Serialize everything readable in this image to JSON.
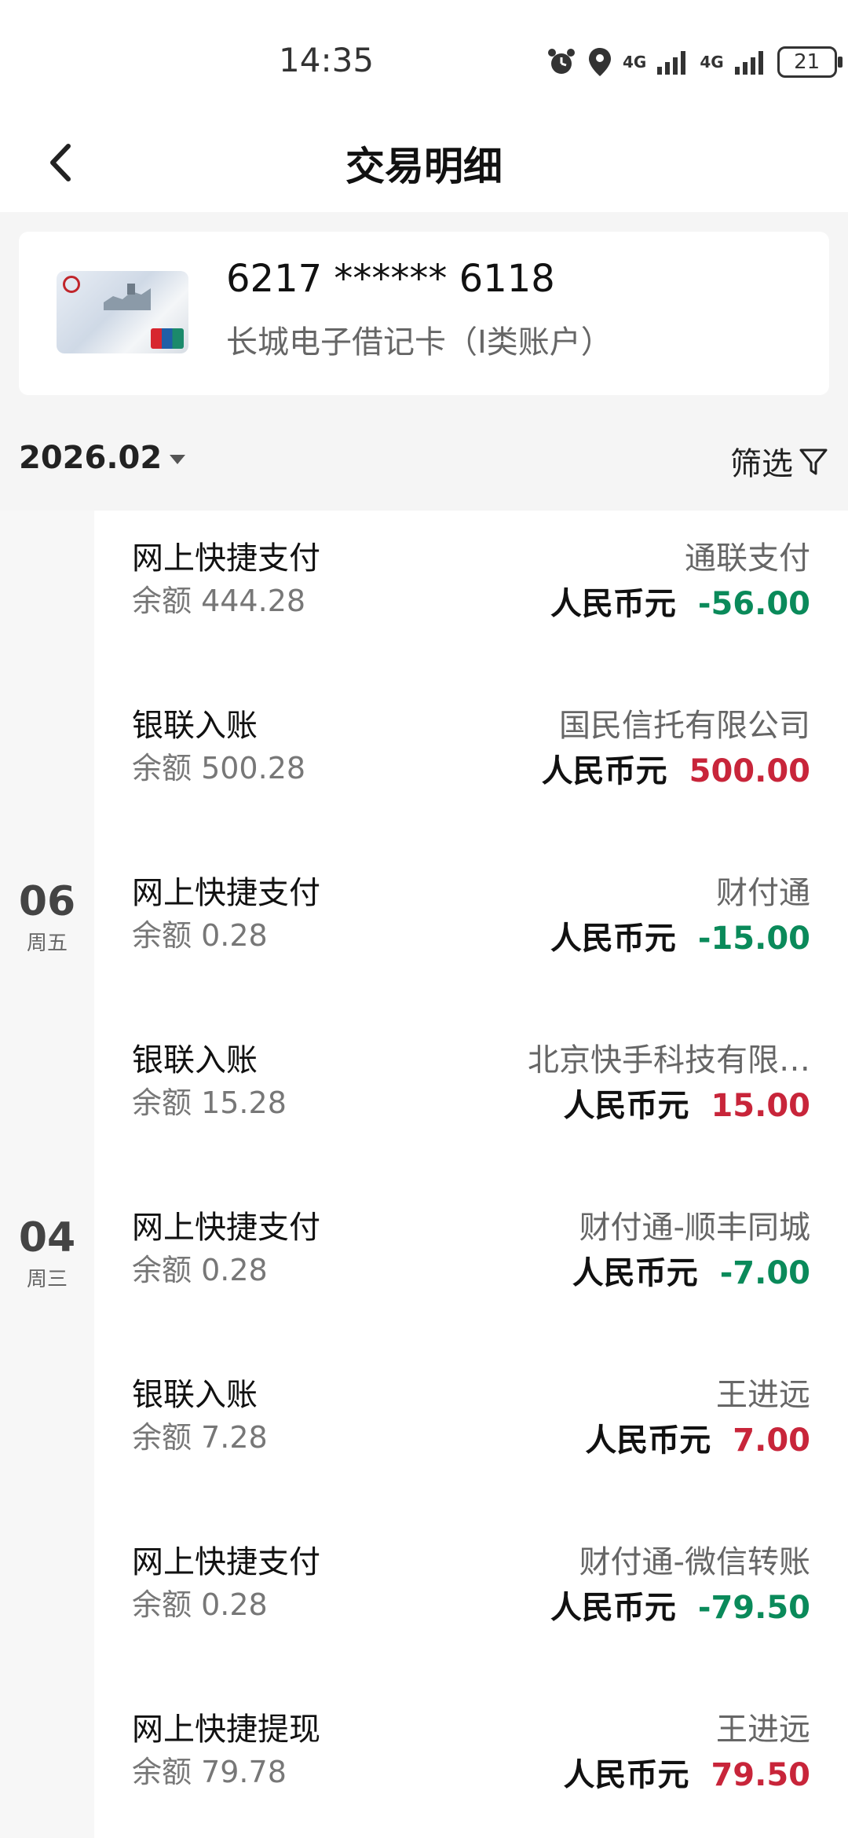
{
  "status": {
    "time": "14:35",
    "battery": "21",
    "sig1": "4G",
    "sig2": "4G"
  },
  "header": {
    "title": "交易明细"
  },
  "card": {
    "number": "6217 ****** 6118",
    "type": "长城电子借记卡（I类账户）"
  },
  "filter": {
    "month": "2026.02",
    "label": "筛选"
  },
  "dates": [
    {
      "day": "06",
      "weekday": "周五"
    },
    {
      "day": "04",
      "weekday": "周三"
    }
  ],
  "transactions": [
    {
      "type": "网上快捷支付",
      "balance": "余额 444.28",
      "counterparty": "通联支付",
      "currency": "人民币元",
      "amount": "-56.00"
    },
    {
      "type": "银联入账",
      "balance": "余额 500.28",
      "counterparty": "国民信托有限公司",
      "currency": "人民币元",
      "amount": "500.00"
    },
    {
      "type": "网上快捷支付",
      "balance": "余额 0.28",
      "counterparty": "财付通",
      "currency": "人民币元",
      "amount": "-15.00"
    },
    {
      "type": "银联入账",
      "balance": "余额 15.28",
      "counterparty": "北京快手科技有限…",
      "currency": "人民币元",
      "amount": "15.00"
    },
    {
      "type": "网上快捷支付",
      "balance": "余额 0.28",
      "counterparty": "财付通-顺丰同城",
      "currency": "人民币元",
      "amount": "-7.00"
    },
    {
      "type": "银联入账",
      "balance": "余额 7.28",
      "counterparty": "王进远",
      "currency": "人民币元",
      "amount": "7.00"
    },
    {
      "type": "网上快捷支付",
      "balance": "余额 0.28",
      "counterparty": "财付通-微信转账",
      "currency": "人民币元",
      "amount": "-79.50"
    },
    {
      "type": "网上快捷提现",
      "balance": "余额 79.78",
      "counterparty": "王进远",
      "currency": "人民币元",
      "amount": "79.50"
    }
  ]
}
